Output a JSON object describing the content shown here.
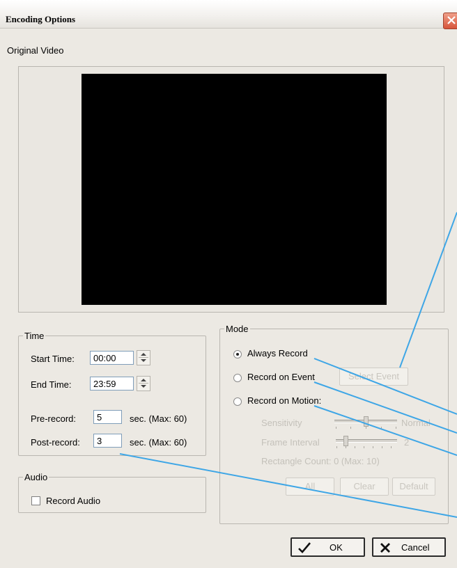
{
  "window": {
    "title": "Encoding Options"
  },
  "video": {
    "label": "Original Video"
  },
  "time": {
    "legend": "Time",
    "start_label": "Start Time:",
    "start_value": "00:00",
    "end_label": "End Time:",
    "end_value": "23:59",
    "pre_label": "Pre-record:",
    "pre_value": "5",
    "pre_unit": "sec.  (Max: 60)",
    "post_label": "Post-record:",
    "post_value": "3",
    "post_unit": "sec.  (Max: 60)"
  },
  "audio": {
    "legend": "Audio",
    "record_label": "Record Audio",
    "record_checked": false
  },
  "mode": {
    "legend": "Mode",
    "always_label": "Always Record",
    "event_label": "Record on Event",
    "motion_label": "Record on Motion:",
    "selected": "Always Record",
    "select_event_label": "Select Event",
    "sensitivity_label": "Sensitivity",
    "sensitivity_value": "Normal",
    "frame_interval_label": "Frame Interval",
    "frame_interval_value": "2",
    "rect_count_label": "Rectangle Count: 0  (Max: 10)",
    "all_label": "All",
    "clear_label": "Clear",
    "default_label": "Default"
  },
  "buttons": {
    "ok": "OK",
    "cancel": "Cancel"
  },
  "colors": {
    "callout": "#3ea6e6",
    "window_bg": "#ece9e3",
    "video_bg": "#000000"
  },
  "icons": [
    "close-icon",
    "check-icon",
    "x-icon",
    "spin-up-icon",
    "spin-down-icon"
  ]
}
